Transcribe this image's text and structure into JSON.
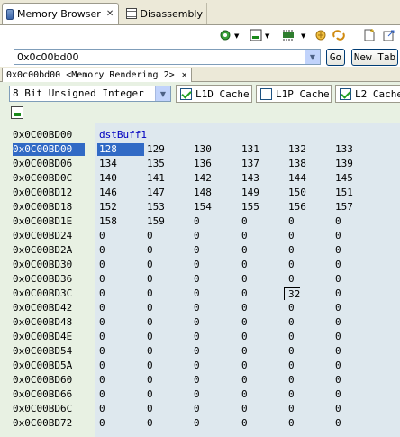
{
  "views": [
    {
      "label": "Memory Browser",
      "icon": "memory-browser-icon",
      "active": true
    },
    {
      "label": "Disassembly",
      "icon": "disassembly-icon",
      "active": false
    }
  ],
  "address": {
    "value": "0x0c00bd00",
    "go_label": "Go",
    "newtab_label": "New Tab"
  },
  "rendering_tab": {
    "label": "0x0c00bd00 <Memory Rendering 2>"
  },
  "format": {
    "selected": "8 Bit Unsigned Integer"
  },
  "caches": [
    {
      "label": "L1D Cache",
      "checked": true
    },
    {
      "label": "L1P Cache",
      "checked": false
    },
    {
      "label": "L2 Cache",
      "checked": true
    }
  ],
  "memory": {
    "label_row": {
      "address": "0x0C00BD00",
      "symbol": "dstBuff1"
    },
    "rows": [
      {
        "address": "0x0C00BD00",
        "values": [
          "128",
          "129",
          "130",
          "131",
          "132",
          "133"
        ]
      },
      {
        "address": "0x0C00BD06",
        "values": [
          "134",
          "135",
          "136",
          "137",
          "138",
          "139"
        ]
      },
      {
        "address": "0x0C00BD0C",
        "values": [
          "140",
          "141",
          "142",
          "143",
          "144",
          "145"
        ]
      },
      {
        "address": "0x0C00BD12",
        "values": [
          "146",
          "147",
          "148",
          "149",
          "150",
          "151"
        ]
      },
      {
        "address": "0x0C00BD18",
        "values": [
          "152",
          "153",
          "154",
          "155",
          "156",
          "157"
        ]
      },
      {
        "address": "0x0C00BD1E",
        "values": [
          "158",
          "159",
          "0",
          "0",
          "0",
          "0"
        ]
      },
      {
        "address": "0x0C00BD24",
        "values": [
          "0",
          "0",
          "0",
          "0",
          "0",
          "0"
        ]
      },
      {
        "address": "0x0C00BD2A",
        "values": [
          "0",
          "0",
          "0",
          "0",
          "0",
          "0"
        ]
      },
      {
        "address": "0x0C00BD30",
        "values": [
          "0",
          "0",
          "0",
          "0",
          "0",
          "0"
        ]
      },
      {
        "address": "0x0C00BD36",
        "values": [
          "0",
          "0",
          "0",
          "0",
          "0",
          "0"
        ]
      },
      {
        "address": "0x0C00BD3C",
        "values": [
          "0",
          "0",
          "0",
          "0",
          "32",
          "0"
        ]
      },
      {
        "address": "0x0C00BD42",
        "values": [
          "0",
          "0",
          "0",
          "0",
          "0",
          "0"
        ]
      },
      {
        "address": "0x0C00BD48",
        "values": [
          "0",
          "0",
          "0",
          "0",
          "0",
          "0"
        ]
      },
      {
        "address": "0x0C00BD4E",
        "values": [
          "0",
          "0",
          "0",
          "0",
          "0",
          "0"
        ]
      },
      {
        "address": "0x0C00BD54",
        "values": [
          "0",
          "0",
          "0",
          "0",
          "0",
          "0"
        ]
      },
      {
        "address": "0x0C00BD5A",
        "values": [
          "0",
          "0",
          "0",
          "0",
          "0",
          "0"
        ]
      },
      {
        "address": "0x0C00BD60",
        "values": [
          "0",
          "0",
          "0",
          "0",
          "0",
          "0"
        ]
      },
      {
        "address": "0x0C00BD66",
        "values": [
          "0",
          "0",
          "0",
          "0",
          "0",
          "0"
        ]
      },
      {
        "address": "0x0C00BD6C",
        "values": [
          "0",
          "0",
          "0",
          "0",
          "0",
          "0"
        ]
      },
      {
        "address": "0x0C00BD72",
        "values": [
          "0",
          "0",
          "0",
          "0",
          "0",
          "0"
        ]
      }
    ],
    "selected_row": 0,
    "selected_col": 0,
    "editing_row": 10,
    "editing_col": 4
  },
  "colors": {
    "selection": "#316ac5",
    "symbol": "#0000c0",
    "panel_bg": "#e8f1e3",
    "data_bg": "#dee8ee"
  }
}
